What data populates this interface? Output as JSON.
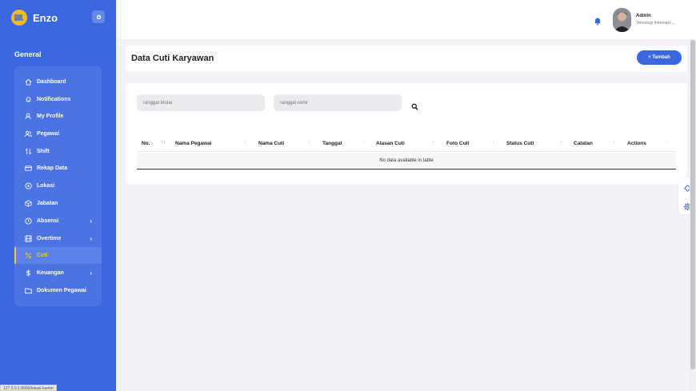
{
  "colors": {
    "sidebar_bg": "#3a67e0",
    "accent_yellow": "#f5c542",
    "primary_button": "#3a67e0",
    "page_bg": "#f2f3f8"
  },
  "brand": {
    "logo_icon": "brand-logo-icon",
    "name": "Enzo"
  },
  "sidebar": {
    "section_title": "General",
    "items": [
      {
        "label": "Dashboard",
        "icon": "home-icon"
      },
      {
        "label": "Notifications",
        "icon": "bell-icon"
      },
      {
        "label": "My Profile",
        "icon": "user-icon"
      },
      {
        "label": "Pegawai",
        "icon": "users-icon"
      },
      {
        "label": "Shift",
        "icon": "swap-icon"
      },
      {
        "label": "Rekap Data",
        "icon": "card-icon"
      },
      {
        "label": "Lokasi",
        "icon": "location-icon"
      },
      {
        "label": "Jabatan",
        "icon": "box-icon"
      },
      {
        "label": "Absensi",
        "icon": "clock-icon",
        "chevron": "›"
      },
      {
        "label": "Overtime",
        "icon": "film-icon",
        "chevron": "›"
      },
      {
        "label": "Cuti",
        "icon": "percent-icon",
        "active": true
      },
      {
        "label": "Keuangan",
        "icon": "dollar-icon",
        "chevron": "›"
      },
      {
        "label": "Dokumen Pegawai",
        "icon": "folder-icon"
      }
    ]
  },
  "status_bar": {
    "url": "127.0.0.1:8000/lokasi-kantor"
  },
  "topbar": {
    "user_name": "Admin",
    "user_role": "Teknologi Informasi",
    "user_role_chevron": "⌄"
  },
  "page": {
    "title": "Data Cuti Karyawan",
    "add_button": "+ Tambah"
  },
  "filters": {
    "start_placeholder": "Tanggal Mulai",
    "end_placeholder": "Tanggal Akhir"
  },
  "table": {
    "columns": [
      "No.",
      "Nama Pegawai",
      "Nama Cuti",
      "Tanggal",
      "Alasan Cuti",
      "Foto Cuti",
      "Status Cuti",
      "Catatan",
      "Actions"
    ],
    "empty_message": "No data available in table",
    "sort_glyph": "↕",
    "sort_active_glyph": "↑↓"
  }
}
